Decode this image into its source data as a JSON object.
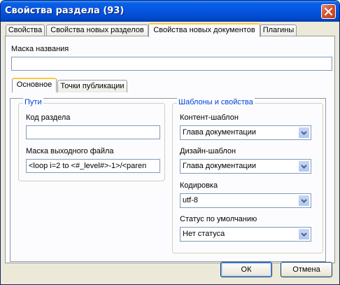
{
  "window": {
    "title": "Свойства раздела (93)"
  },
  "outer_tabs": [
    {
      "label": "Свойства"
    },
    {
      "label": "Свойства новых разделов"
    },
    {
      "label": "Свойства новых документов"
    },
    {
      "label": "Плагины"
    }
  ],
  "mask": {
    "label": "Маска названия",
    "value": ""
  },
  "inner_tabs": [
    {
      "label": "Основное"
    },
    {
      "label": "Точки публикации"
    }
  ],
  "paths_group": {
    "legend": "Пути",
    "section_code": {
      "label": "Код раздела",
      "value": ""
    },
    "output_mask": {
      "label": "Маска выходного файла",
      "value": "<loop i=2 to <#_level#>-1>/<paren"
    }
  },
  "templates_group": {
    "legend": "Шаблоны и свойства",
    "content_template": {
      "label": "Контент-шаблон",
      "value": "Глава документации"
    },
    "design_template": {
      "label": "Дизайн-шаблон",
      "value": "Глава документации"
    },
    "encoding": {
      "label": "Кодировка",
      "value": "utf-8"
    },
    "default_status": {
      "label": "Статус по умолчанию",
      "value": "Нет статуса"
    }
  },
  "buttons": {
    "ok": "ОК",
    "cancel": "Отмена"
  }
}
